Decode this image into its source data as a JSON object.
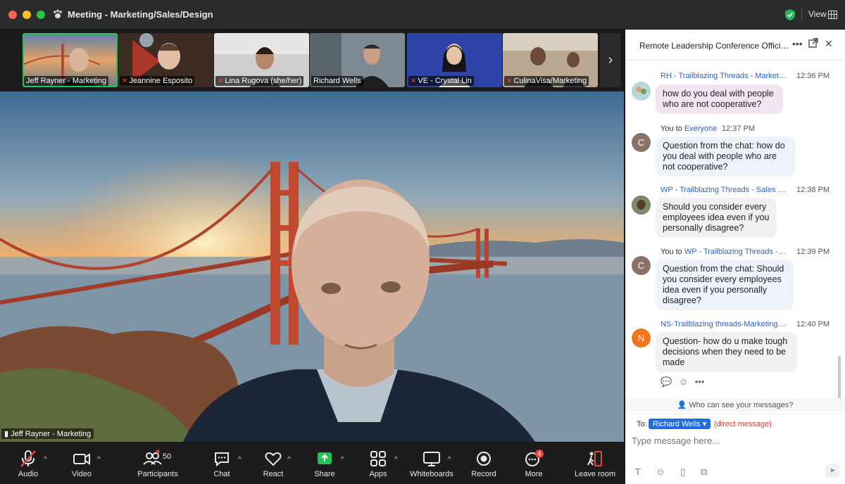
{
  "window": {
    "title": "Meeting - Marketing/Sales/Design",
    "view_label": "View"
  },
  "thumbnails": [
    {
      "name": "Jeff Rayner - Marketing",
      "muted": false,
      "active": true
    },
    {
      "name": "Jeannine Esposito",
      "muted": true,
      "active": false
    },
    {
      "name": "Lina Rugova (she/her)",
      "muted": true,
      "active": false
    },
    {
      "name": "Richard Wells",
      "muted": false,
      "active": false
    },
    {
      "name": "VE - Crystal Lin",
      "muted": true,
      "active": false
    },
    {
      "name": "CulinaVisa/Marketing",
      "muted": true,
      "active": false
    }
  ],
  "main_video": {
    "label": "Jeff Rayner - Marketing"
  },
  "toolbar": {
    "audio": "Audio",
    "video": "Video",
    "participants": "Participants",
    "participants_count": "50",
    "chat": "Chat",
    "react": "React",
    "share": "Share",
    "apps": "Apps",
    "whiteboards": "Whiteboards",
    "record": "Record",
    "more": "More",
    "more_badge": "4",
    "leave": "Leave room"
  },
  "chat": {
    "title": "Remote Leadership Conference Official...",
    "messages": [
      {
        "avatar": "",
        "sender_prefix": "",
        "sender": "RH - Trailblazing Threads - Marketin...",
        "time": "12:36 PM",
        "text": "how do you deal with people who are not cooperative?"
      },
      {
        "avatar": "C",
        "sender_prefix": "You to",
        "sender": "Everyone",
        "time": "12:37 PM",
        "text": "Question from the chat: how do you deal with people who are not cooperative?"
      },
      {
        "avatar": "",
        "sender_prefix": "",
        "sender": "WP - Trailblazing Threads - Sales to...",
        "time": "12:38 PM",
        "text": "Should you consider every employees idea even if you personally disagree?"
      },
      {
        "avatar": "C",
        "sender_prefix": "You to",
        "sender": "WP - Trailblazing Threads - Sa...",
        "time": "12:39 PM",
        "text": "Question from the chat: Should you consider every employees idea even if you personally disagree?"
      },
      {
        "avatar": "N",
        "sender_prefix": "",
        "sender": "NS-Trailblazing threads-Marketing d...",
        "time": "12:40 PM",
        "text": "Question- how do u make tough decisions when they need to be made"
      }
    ],
    "who_can_see": "Who can see your messages?",
    "to_label": "To:",
    "recipient": "Richard Wells",
    "direct_message": "(direct message)",
    "placeholder": "Type message here..."
  }
}
